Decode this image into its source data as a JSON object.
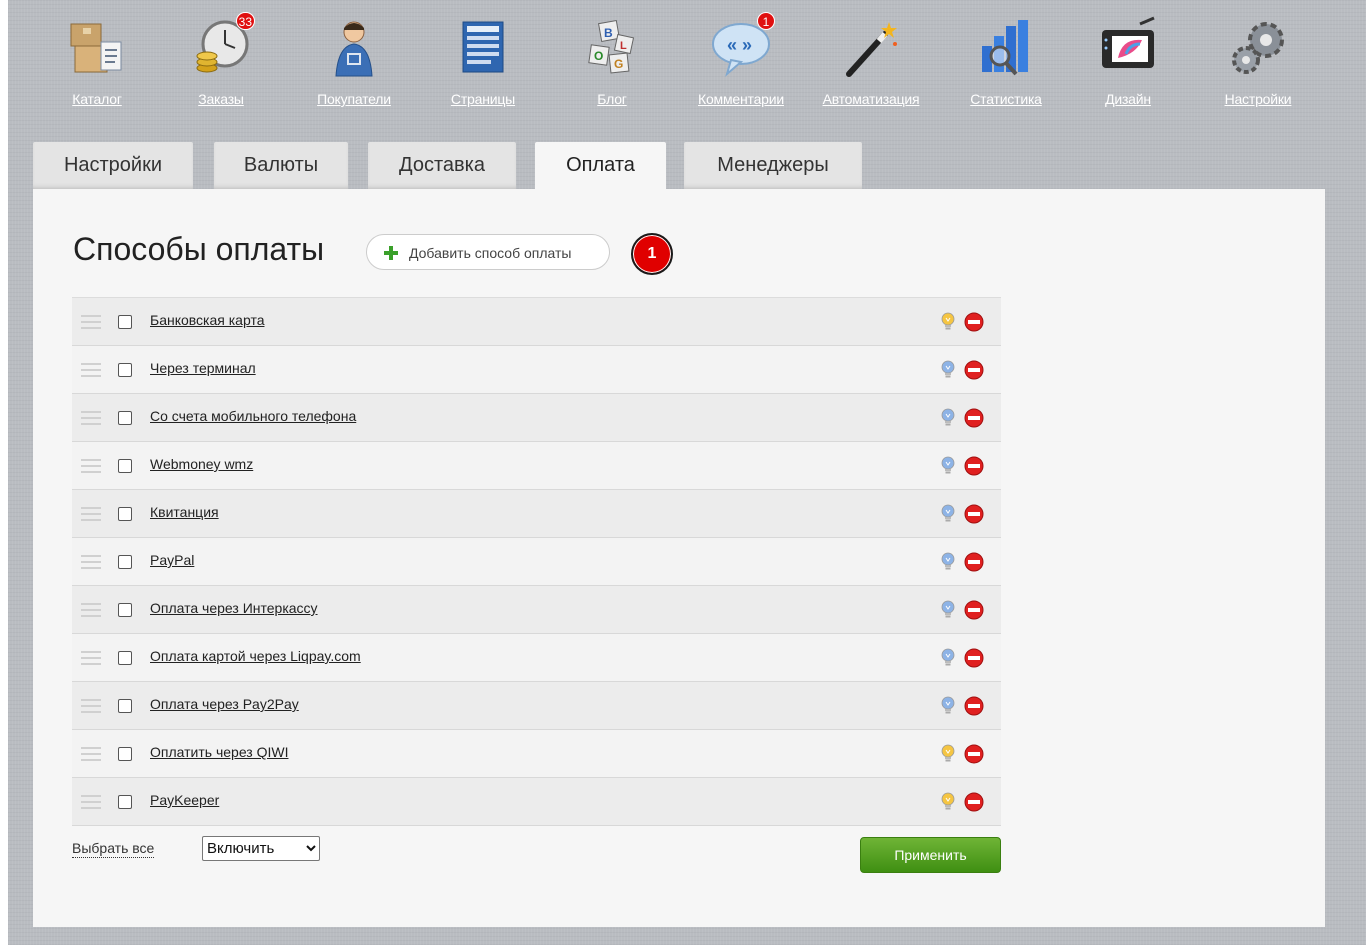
{
  "nav": {
    "items": [
      {
        "label": "Каталог",
        "icon": "box-icon"
      },
      {
        "label": "Заказы",
        "icon": "clock-coins-icon",
        "badge": "33"
      },
      {
        "label": "Покупатели",
        "icon": "person-cart-icon"
      },
      {
        "label": "Страницы",
        "icon": "pages-icon"
      },
      {
        "label": "Блог",
        "icon": "blog-cubes-icon"
      },
      {
        "label": "Комментарии",
        "icon": "speech-bubble-icon",
        "badge": "1"
      },
      {
        "label": "Автоматизация",
        "icon": "magic-wand-icon"
      },
      {
        "label": "Статистика",
        "icon": "chart-icon"
      },
      {
        "label": "Дизайн",
        "icon": "design-tablet-icon"
      },
      {
        "label": "Настройки",
        "icon": "gears-icon"
      }
    ]
  },
  "tabs": [
    "Настройки",
    "Валюты",
    "Доставка",
    "Оплата",
    "Менеджеры"
  ],
  "active_tab": "Оплата",
  "main": {
    "title": "Способы оплаты",
    "add_button_label": "Добавить способ оплаты",
    "count_badge": "1",
    "rows": [
      {
        "name": "Банковская карта",
        "enabled": true
      },
      {
        "name": "Через терминал",
        "enabled": false
      },
      {
        "name": "Со счета мобильного телефона",
        "enabled": false
      },
      {
        "name": "Webmoney wmz",
        "enabled": false
      },
      {
        "name": "Квитанция",
        "enabled": false
      },
      {
        "name": "PayPal",
        "enabled": false
      },
      {
        "name": "Оплата через Интеркассу",
        "enabled": false
      },
      {
        "name": "Оплата картой через Liqpay.com",
        "enabled": false
      },
      {
        "name": "Оплата через Pay2Pay",
        "enabled": false
      },
      {
        "name": "Оплатить через QIWI",
        "enabled": true
      },
      {
        "name": "PayKeeper",
        "enabled": true
      }
    ]
  },
  "footer": {
    "select_all_label": "Выбрать все",
    "action_selected": "Включить",
    "apply_label": "Применить"
  },
  "colors": {
    "bulb_on": "#f5c542",
    "bulb_off": "#8db3e6",
    "delete": "#e02020",
    "apply_green": "#4f9f1f",
    "badge_red": "#e00000"
  }
}
